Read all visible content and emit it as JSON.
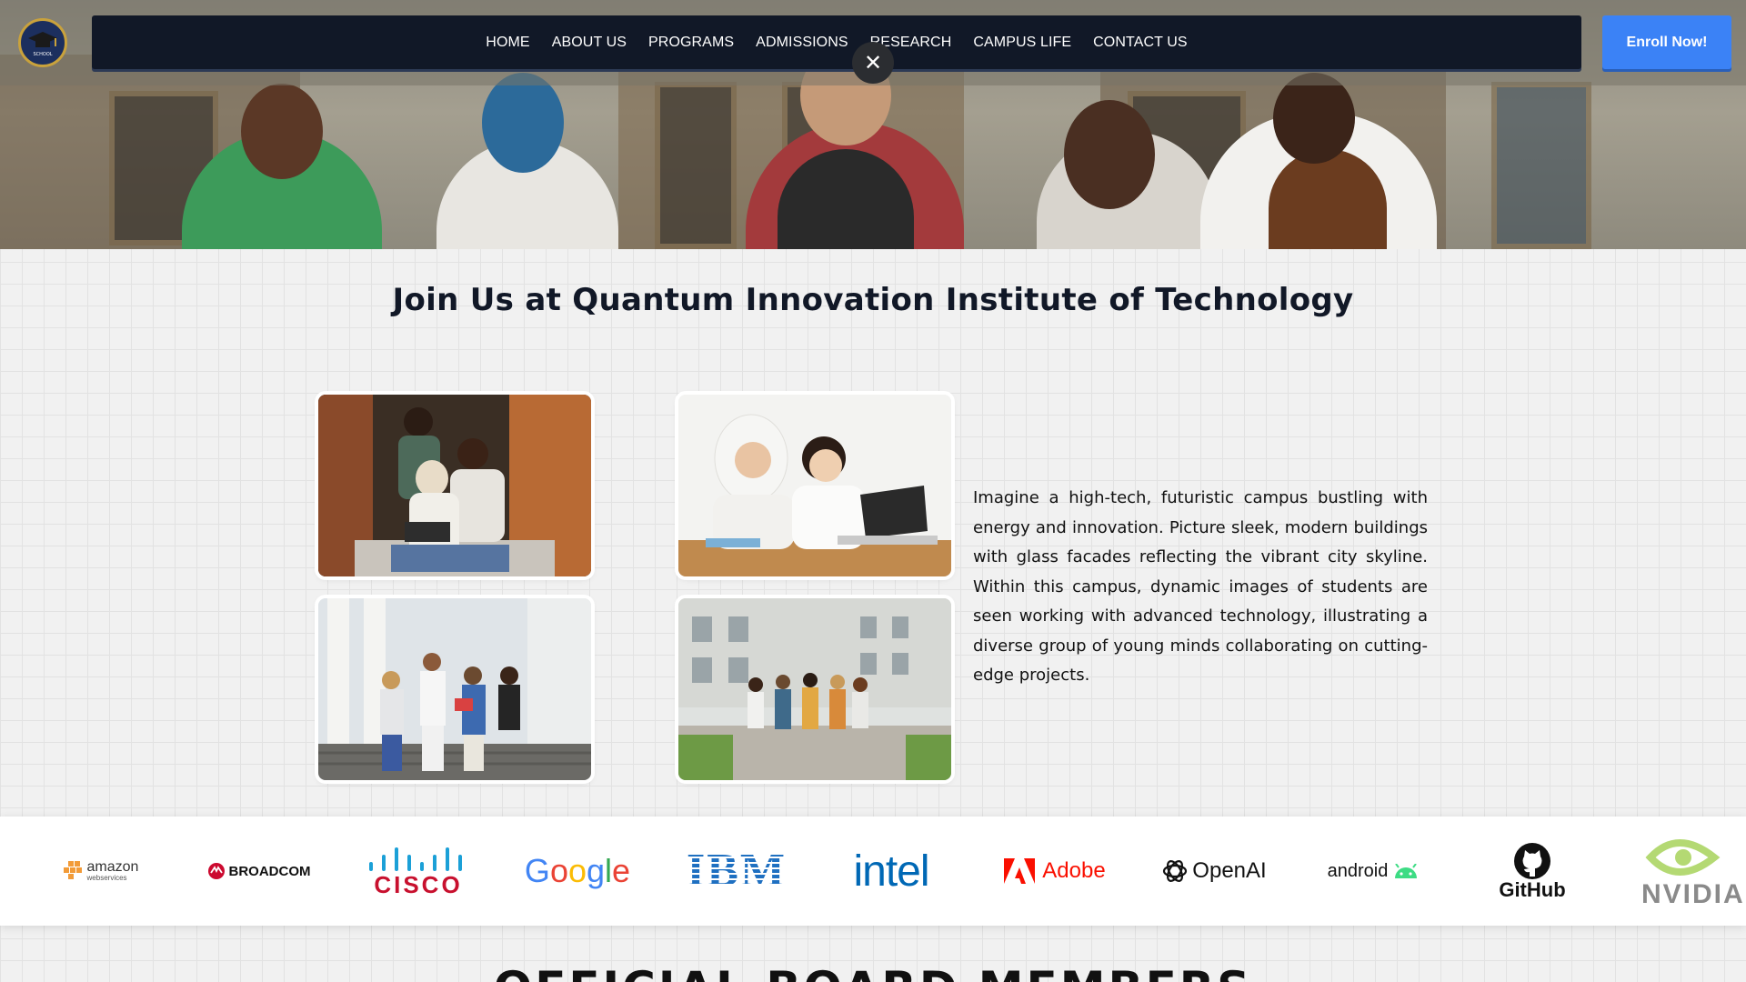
{
  "nav": {
    "items": [
      "HOME",
      "ABOUT US",
      "PROGRAMS",
      "ADMISSIONS",
      "RESEARCH",
      "CAMPUS LIFE",
      "CONTACT US"
    ]
  },
  "enroll_label": "Enroll Now!",
  "close_label": "✕",
  "logo_text": "SCHOOL",
  "join": {
    "title": "Join Us at Quantum Innovation Institute of Technology",
    "text": "Imagine a high-tech, futuristic campus bustling with energy and innovation. Picture sleek, modern buildings with glass facades reflecting the vibrant city skyline. Within this campus, dynamic images of students are seen working with advanced technology, illustrating a diverse group of young minds collaborating on cutting-edge projects."
  },
  "partners": {
    "amazon": "amazon",
    "amazon_sub": "webservices",
    "broadcom": "BROADCOM",
    "cisco": "CISCO",
    "google": "Google",
    "ibm": "IBM",
    "intel": "intel",
    "adobe": "Adobe",
    "openai": "OpenAI",
    "android": "android",
    "github": "GitHub",
    "nvidia": "NVIDIA"
  },
  "board_title": "OFFICIAL BOARD MEMBERS",
  "colors": {
    "nav_bg": "#111827",
    "accent_blue": "#3b82f6",
    "google_blue": "#4285F4",
    "google_red": "#EA4335",
    "google_yellow": "#FBBC05",
    "google_green": "#34A853",
    "cisco_blue": "#1BA0D7",
    "ibm_blue": "#1F70C1",
    "intel_blue": "#0068B5",
    "adobe_red": "#FA0F00",
    "broadcom_red": "#CC092F",
    "android_green": "#3DDC84",
    "nvidia_green": "#76B900"
  }
}
